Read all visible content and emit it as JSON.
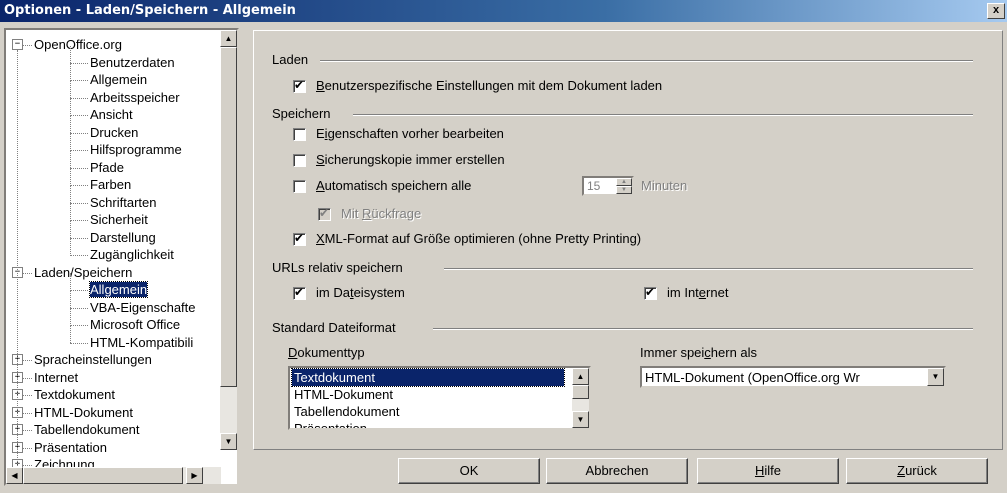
{
  "window": {
    "title": "Optionen - Laden/Speichern - Allgemein",
    "close": "x"
  },
  "tree": {
    "items": [
      {
        "label": "OpenOffice.org",
        "expander": "−"
      },
      {
        "label": "Benutzerdaten"
      },
      {
        "label": "Allgemein"
      },
      {
        "label": "Arbeitsspeicher"
      },
      {
        "label": "Ansicht"
      },
      {
        "label": "Drucken"
      },
      {
        "label": "Hilfsprogramme"
      },
      {
        "label": "Pfade"
      },
      {
        "label": "Farben"
      },
      {
        "label": "Schriftarten"
      },
      {
        "label": "Sicherheit"
      },
      {
        "label": "Darstellung"
      },
      {
        "label": "Zugänglichkeit"
      },
      {
        "label": "Laden/Speichern",
        "expander": "−"
      },
      {
        "label": "Allgemein",
        "selected": true
      },
      {
        "label": "VBA-Eigenschafte"
      },
      {
        "label": "Microsoft Office"
      },
      {
        "label": "HTML-Kompatibili"
      },
      {
        "label": "Spracheinstellungen",
        "expander": "+"
      },
      {
        "label": "Internet",
        "expander": "+"
      },
      {
        "label": "Textdokument",
        "expander": "+"
      },
      {
        "label": "HTML-Dokument",
        "expander": "+"
      },
      {
        "label": "Tabellendokument",
        "expander": "+"
      },
      {
        "label": "Präsentation",
        "expander": "+"
      },
      {
        "label": "Zeichnung",
        "expander": "+"
      }
    ]
  },
  "laden": {
    "title": "Laden",
    "user_settings": {
      "label": "enutzerspezifische Einstellungen mit dem Dokument laden",
      "accel": "B",
      "checked": true
    }
  },
  "speichern": {
    "title": "Speichern",
    "edit_props": {
      "pre": "E",
      "accel": "i",
      "post": "genschaften vorher bearbeiten",
      "checked": false
    },
    "backup": {
      "accel": "S",
      "post": "icherungskopie immer erstellen",
      "checked": false
    },
    "autosave": {
      "accel": "A",
      "post": "utomatisch speichern alle",
      "checked": false,
      "minutes": "15",
      "unit": "Minuten"
    },
    "prompt": {
      "pre": "Mit ",
      "accel": "R",
      "post": "ückfrage",
      "checked": true,
      "disabled": true
    },
    "xml": {
      "accel": "X",
      "post": "ML-Format auf Größe optimieren (ohne Pretty Printing)",
      "checked": true
    }
  },
  "urls": {
    "title": "URLs relativ speichern",
    "filesystem": {
      "pre": "im Da",
      "accel": "t",
      "post": "eisystem",
      "checked": true
    },
    "internet": {
      "pre": "im Int",
      "accel": "e",
      "post": "rnet",
      "checked": true
    }
  },
  "format": {
    "title": "Standard Dateiformat",
    "doctype_label": {
      "accel": "D",
      "post": "okumenttyp"
    },
    "saveas_label": {
      "pre": "Immer spei",
      "accel": "c",
      "post": "hern als"
    },
    "doctypes": [
      "Textdokument",
      "HTML-Dokument",
      "Tabellendokument",
      "Präsentation"
    ],
    "selected_doctype": "Textdokument",
    "saveas_value": "HTML-Dokument (OpenOffice.org Wr"
  },
  "buttons": {
    "ok": "OK",
    "cancel": "Abbrechen",
    "help": {
      "accel": "H",
      "post": "ilfe"
    },
    "back": {
      "accel": "Z",
      "post": "urück"
    }
  }
}
